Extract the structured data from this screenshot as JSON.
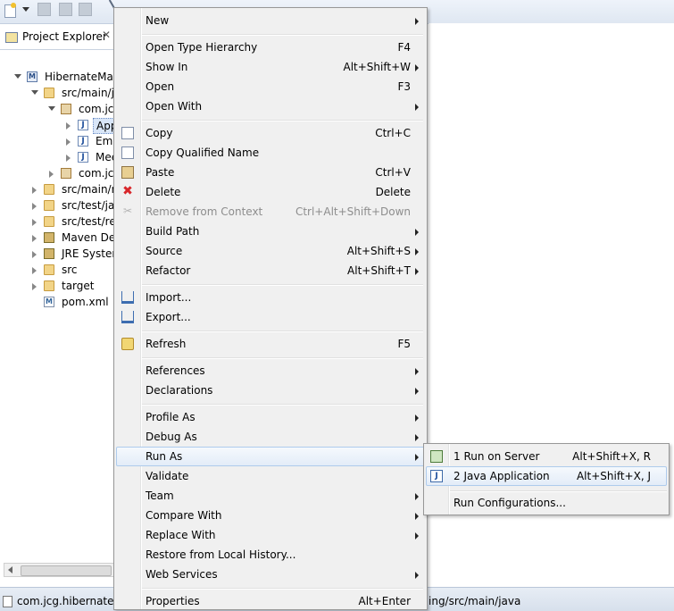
{
  "explorer": {
    "tab_title": "Project Explorer",
    "tab_close": "✕",
    "tree": [
      {
        "label": "HibernateMany",
        "icon": "project-icon"
      },
      {
        "label": "src/main/ja",
        "icon": "source-folder-icon"
      },
      {
        "label": "com.jcg",
        "icon": "package-icon"
      },
      {
        "label": "App",
        "icon": "java-file-icon"
      },
      {
        "label": "Emp",
        "icon": "java-file-icon"
      },
      {
        "label": "Mee",
        "icon": "java-file-icon"
      },
      {
        "label": "com.jcg",
        "icon": "package-icon"
      },
      {
        "label": "src/main/re",
        "icon": "source-folder-icon"
      },
      {
        "label": "src/test/jav",
        "icon": "source-folder-icon"
      },
      {
        "label": "src/test/res",
        "icon": "source-folder-icon"
      },
      {
        "label": "Maven Dep",
        "icon": "library-icon"
      },
      {
        "label": "JRE System",
        "icon": "library-icon"
      },
      {
        "label": "src",
        "icon": "folder-icon"
      },
      {
        "label": "target",
        "icon": "folder-icon"
      },
      {
        "label": "pom.xml",
        "icon": "xml-file-icon"
      }
    ]
  },
  "status": {
    "left": "com.jcg.hibernate.m",
    "right": "ing/src/main/java"
  },
  "context_menu": {
    "items": [
      {
        "label": "New",
        "shortcut": ""
      },
      {
        "label": "Open Type Hierarchy",
        "shortcut": "F4"
      },
      {
        "label": "Show In",
        "shortcut": "Alt+Shift+W"
      },
      {
        "label": "Open",
        "shortcut": "F3"
      },
      {
        "label": "Open With",
        "shortcut": ""
      },
      {
        "label": "Copy",
        "shortcut": "Ctrl+C"
      },
      {
        "label": "Copy Qualified Name",
        "shortcut": ""
      },
      {
        "label": "Paste",
        "shortcut": "Ctrl+V"
      },
      {
        "label": "Delete",
        "shortcut": "Delete"
      },
      {
        "label": "Remove from Context",
        "shortcut": "Ctrl+Alt+Shift+Down"
      },
      {
        "label": "Build Path",
        "shortcut": ""
      },
      {
        "label": "Source",
        "shortcut": "Alt+Shift+S"
      },
      {
        "label": "Refactor",
        "shortcut": "Alt+Shift+T"
      },
      {
        "label": "Import...",
        "shortcut": ""
      },
      {
        "label": "Export...",
        "shortcut": ""
      },
      {
        "label": "Refresh",
        "shortcut": "F5"
      },
      {
        "label": "References",
        "shortcut": ""
      },
      {
        "label": "Declarations",
        "shortcut": ""
      },
      {
        "label": "Profile As",
        "shortcut": ""
      },
      {
        "label": "Debug As",
        "shortcut": ""
      },
      {
        "label": "Run As",
        "shortcut": ""
      },
      {
        "label": "Validate",
        "shortcut": ""
      },
      {
        "label": "Team",
        "shortcut": ""
      },
      {
        "label": "Compare With",
        "shortcut": ""
      },
      {
        "label": "Replace With",
        "shortcut": ""
      },
      {
        "label": "Restore from Local History...",
        "shortcut": ""
      },
      {
        "label": "Web Services",
        "shortcut": ""
      },
      {
        "label": "Properties",
        "shortcut": "Alt+Enter"
      }
    ]
  },
  "run_as_submenu": {
    "items": [
      {
        "label": "1 Run on Server",
        "shortcut": "Alt+Shift+X, R"
      },
      {
        "label": "2 Java Application",
        "shortcut": "Alt+Shift+X, J"
      },
      {
        "label": "Run Configurations...",
        "shortcut": ""
      }
    ]
  }
}
